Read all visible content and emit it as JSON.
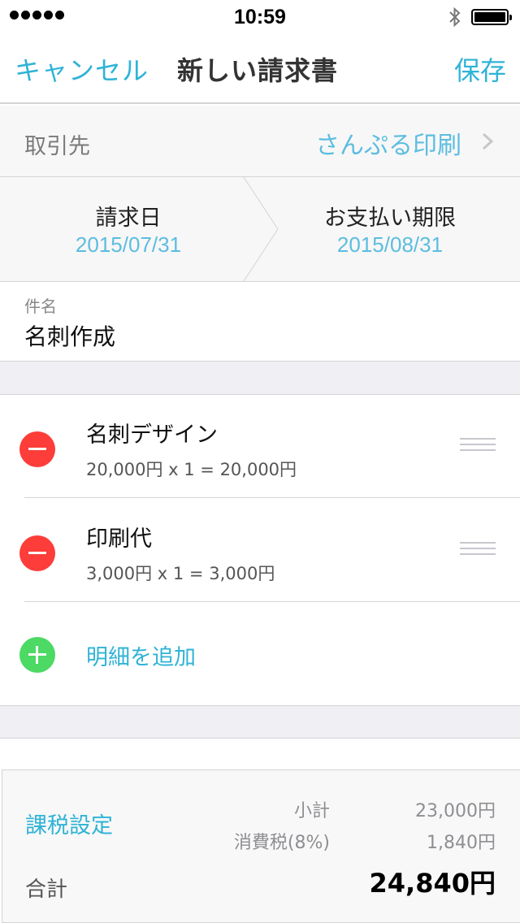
{
  "status_bar": {
    "time": "10:59",
    "icons": [
      "signal-dots-icon",
      "bluetooth-icon",
      "battery-icon"
    ]
  },
  "nav": {
    "cancel": "キャンセル",
    "title": "新しい請求書",
    "save": "保存"
  },
  "client": {
    "label": "取引先",
    "value": "さんぷる印刷"
  },
  "dates": {
    "invoice_label": "請求日",
    "invoice_date": "2015/07/31",
    "due_label": "お支払い期限",
    "due_date": "2015/08/31"
  },
  "subject": {
    "label": "件名",
    "value": "名刺作成"
  },
  "line_items": [
    {
      "name": "名刺デザイン",
      "calc": "20,000円 x 1 = 20,000円"
    },
    {
      "name": "印刷代",
      "calc": "3,000円 x 1 = 3,000円"
    }
  ],
  "add_item": "明細を追加",
  "totals": {
    "tax_setting": "課税設定",
    "subtotal_label": "小計",
    "subtotal_value": "23,000円",
    "tax_label": "消費税(8%)",
    "tax_value": "1,840円",
    "total_label": "合計",
    "total_value": "24,840円"
  },
  "colors": {
    "accent": "#2fb3d6",
    "remove": "#fc3d39",
    "add": "#4cd964"
  }
}
